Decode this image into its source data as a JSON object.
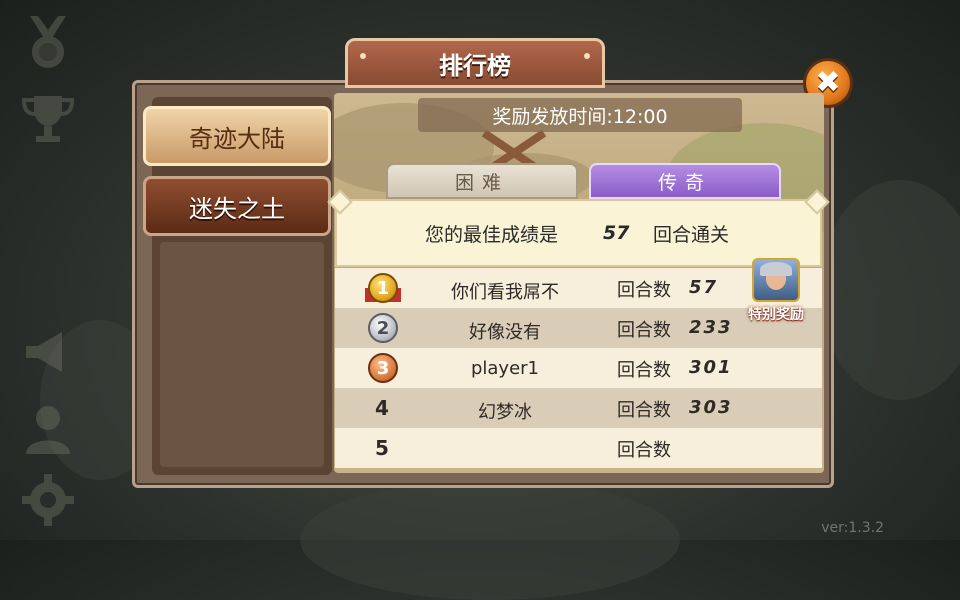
{
  "title": "排行榜",
  "close_glyph": "✖",
  "sidebar": {
    "items": [
      {
        "label": "奇迹大陆",
        "active": true
      },
      {
        "label": "迷失之土",
        "active": false
      }
    ]
  },
  "reward_time": "奖励发放时间:12:00",
  "tabs": [
    {
      "label": "困难",
      "active": false
    },
    {
      "label": "传奇",
      "active": true
    }
  ],
  "best": {
    "prefix": "您的最佳成绩是",
    "value": "57",
    "suffix": "回合通关"
  },
  "rows": [
    {
      "rank": "1",
      "name": "你们看我屌不",
      "round_label": "回合数",
      "rounds": "57"
    },
    {
      "rank": "2",
      "name": "好像没有",
      "round_label": "回合数",
      "rounds": "233"
    },
    {
      "rank": "3",
      "name": "player1",
      "round_label": "回合数",
      "rounds": "301"
    },
    {
      "rank": "4",
      "name": "幻梦冰",
      "round_label": "回合数",
      "rounds": "303"
    },
    {
      "rank": "5",
      "name": "",
      "round_label": "回合数",
      "rounds": ""
    }
  ],
  "special_reward": "特别奖励",
  "version": "ver:1.3.2",
  "colors": {
    "accent_orange": "#e0781c",
    "legend_tab": "#8b5cc8",
    "title_tab": "#8a4a33"
  }
}
